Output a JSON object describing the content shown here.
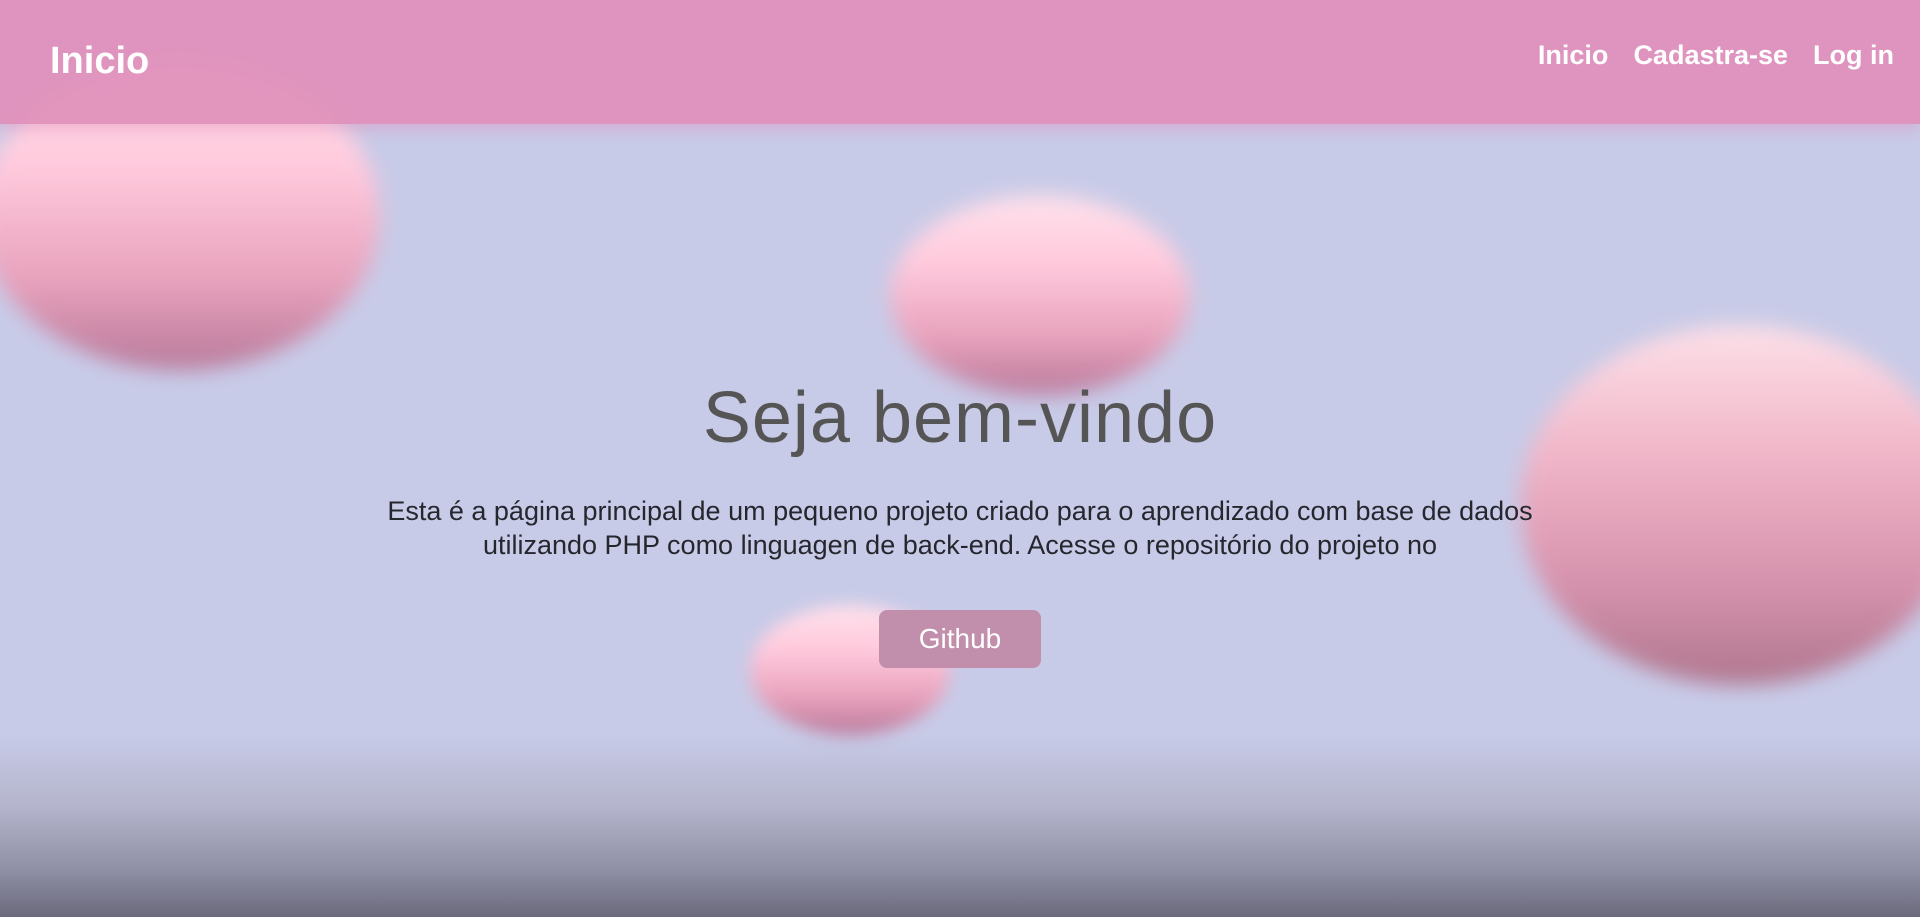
{
  "navbar": {
    "brand": "Inicio",
    "links": [
      "Inicio",
      "Cadastra-se",
      "Log in"
    ]
  },
  "hero": {
    "title": "Seja bem-vindo",
    "description": "Esta é a página principal de um pequeno projeto criado para o aprendizado com base de dados utilizando PHP como linguagen de back-end. Acesse o repositório do projeto no",
    "button_label": "Github"
  },
  "colors": {
    "navbar": "#e08fba",
    "background": "#c8cbe8",
    "button": "#c18fab",
    "blob": "#ffc9dc"
  }
}
